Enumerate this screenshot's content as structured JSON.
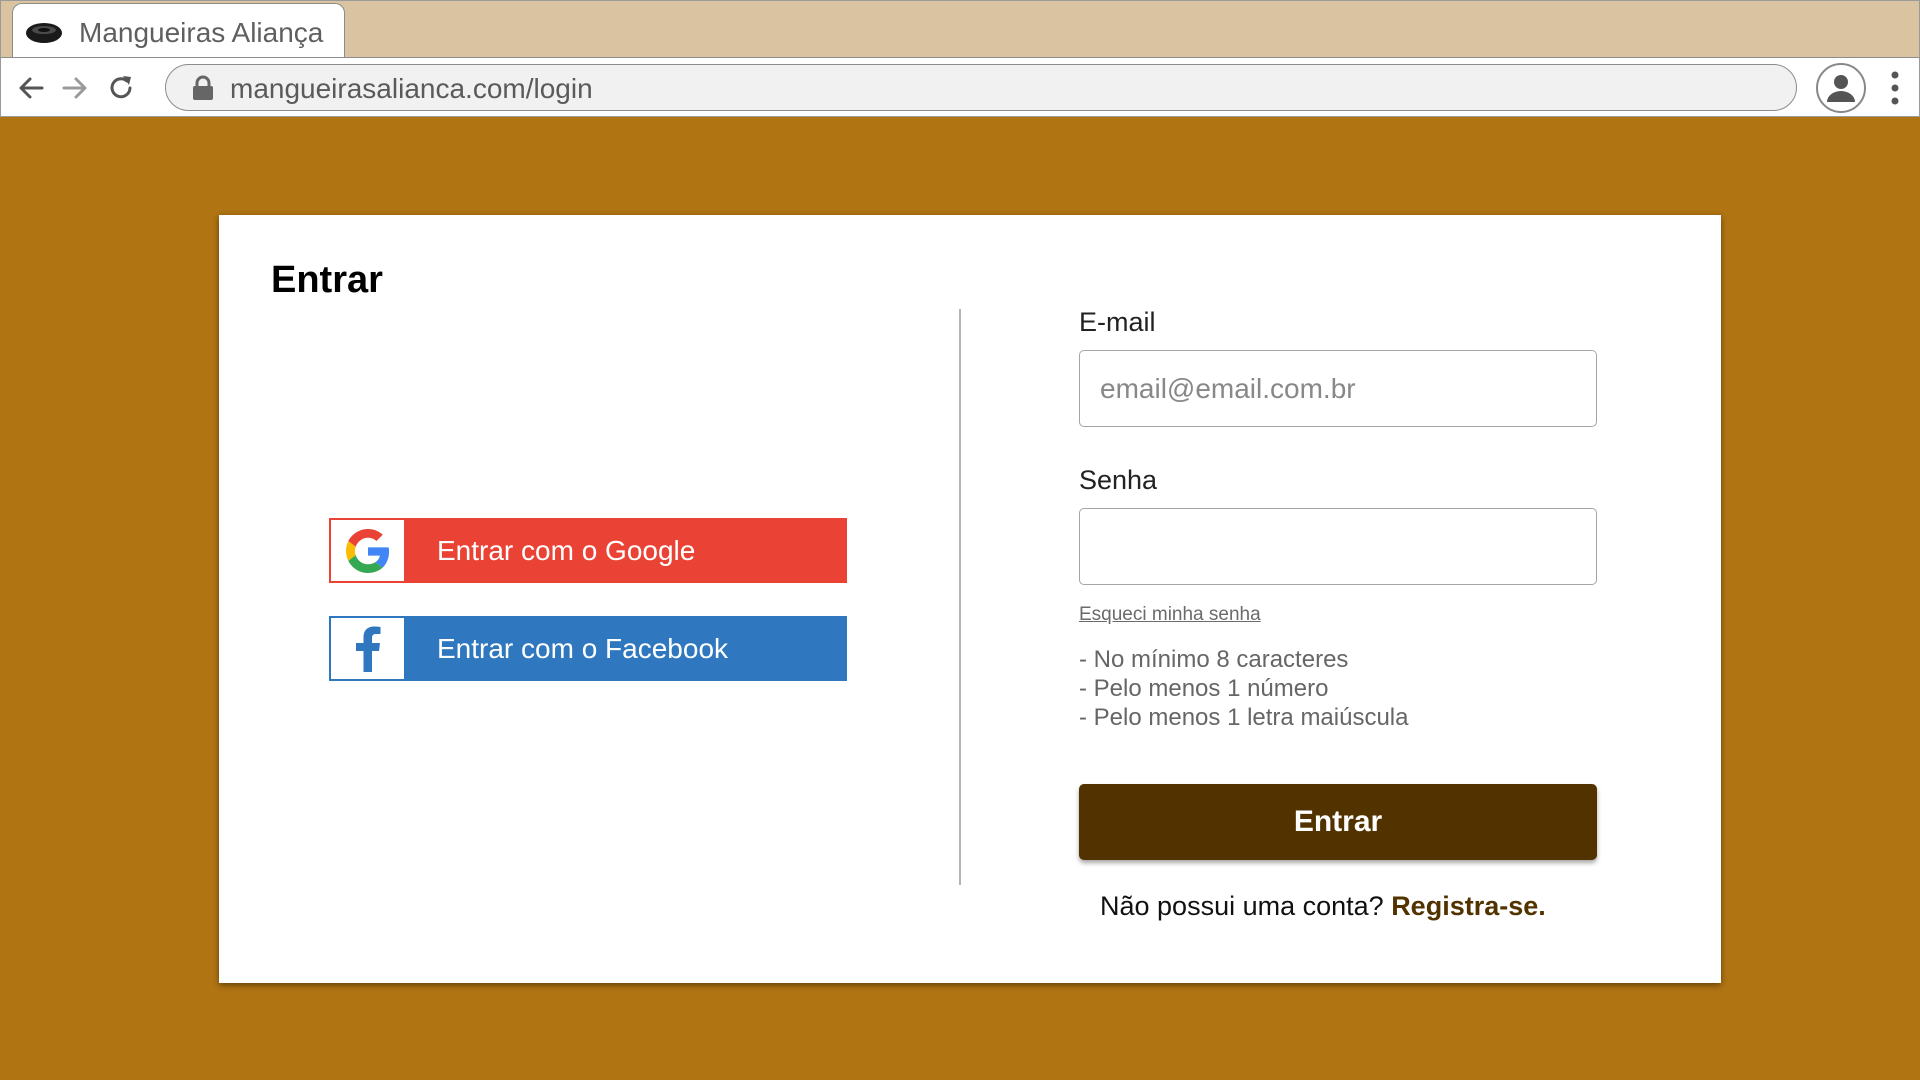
{
  "browser": {
    "tab_title": "Mangueiras Aliança",
    "url": "mangueirasalianca.com/login"
  },
  "colors": {
    "page_background": "#b07413",
    "tab_bar": "#d9c3a0",
    "google_button": "#ea4335",
    "facebook_button": "#2f78bf",
    "primary_button": "#523300"
  },
  "login": {
    "title": "Entrar",
    "google_button": {
      "label": "Entrar com o Google",
      "icon": "google-icon"
    },
    "facebook_button": {
      "label": "Entrar com o Facebook",
      "icon": "facebook-icon"
    },
    "email": {
      "label": "E-mail",
      "placeholder": "email@email.com.br",
      "value": ""
    },
    "password": {
      "label": "Senha",
      "value": ""
    },
    "forgot_password": "Esqueci minha senha",
    "password_rules": [
      "- No mínimo 8 caracteres",
      "- Pelo menos 1 número",
      "- Pelo menos 1 letra maiúscula"
    ],
    "submit_label": "Entrar",
    "register_prompt": "Não possui uma conta? ",
    "register_link": "Registra-se."
  }
}
